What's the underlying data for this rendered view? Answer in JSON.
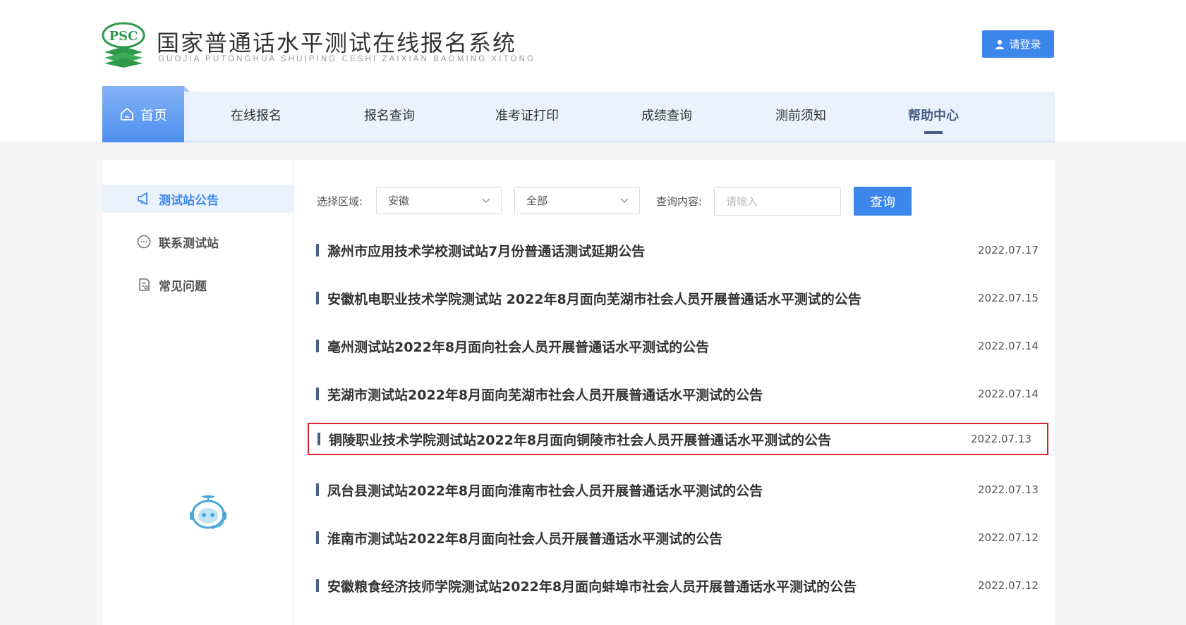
{
  "header": {
    "logo_badge": "PSC",
    "title": "国家普通话水平测试在线报名系统",
    "subtitle": "GUOJIA PUTONGHUA SHUIPING CESHI ZAIXIAN BAOMING XITONG",
    "login_label": "请登录"
  },
  "nav": {
    "home": "首页",
    "items": [
      "在线报名",
      "报名查询",
      "准考证打印",
      "成绩查询",
      "测前须知",
      "帮助中心"
    ],
    "active_index": 5
  },
  "sidebar": {
    "items": [
      "测试站公告",
      "联系测试站",
      "常见问题"
    ],
    "active_index": 0
  },
  "filter": {
    "region_label": "选择区域:",
    "region_value": "安徽",
    "scope_value": "全部",
    "query_label": "查询内容:",
    "query_placeholder": "请输入",
    "query_button": "查询"
  },
  "announcements": [
    {
      "title": "滁州市应用技术学校测试站7月份普通话测试延期公告",
      "date": "2022.07.17"
    },
    {
      "title": "安徽机电职业技术学院测试站 2022年8月面向芜湖市社会人员开展普通话水平测试的公告",
      "date": "2022.07.15"
    },
    {
      "title": "亳州测试站2022年8月面向社会人员开展普通话水平测试的公告",
      "date": "2022.07.14"
    },
    {
      "title": "芜湖市测试站2022年8月面向芜湖市社会人员开展普通话水平测试的公告",
      "date": "2022.07.14"
    },
    {
      "title": "铜陵职业技术学院测试站2022年8月面向铜陵市社会人员开展普通话水平测试的公告",
      "date": "2022.07.13"
    },
    {
      "title": "凤台县测试站2022年8月面向淮南市社会人员开展普通话水平测试的公告",
      "date": "2022.07.13"
    },
    {
      "title": "淮南市测试站2022年8月面向社会人员开展普通话水平测试的公告",
      "date": "2022.07.12"
    },
    {
      "title": "安徽粮食经济技师学院测试站2022年8月面向蚌埠市社会人员开展普通话水平测试的公告",
      "date": "2022.07.12"
    }
  ],
  "colors": {
    "accent": "#3d86ec",
    "nav_active": "#4a5f86",
    "highlight_border": "#d9232f",
    "logo_green": "#2e9a4a"
  }
}
